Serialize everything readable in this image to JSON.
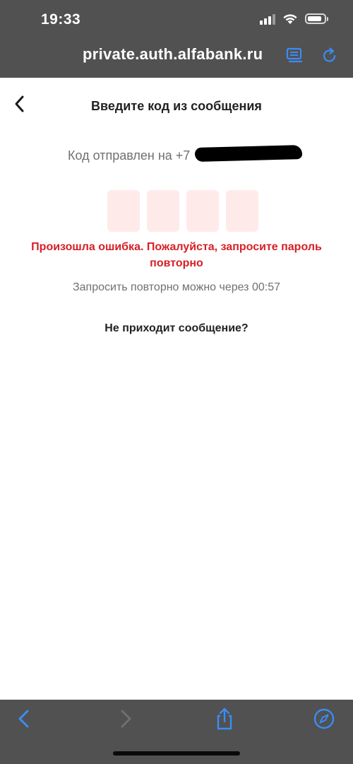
{
  "status_bar": {
    "time": "19:33",
    "battery_level": 0.85,
    "signal_bars": 3
  },
  "browser": {
    "url": "private.auth.alfabank.ru",
    "reader_icon": "reader-view-icon",
    "reload_icon": "reload-icon",
    "accent_color": "#3b8cf5"
  },
  "page": {
    "title": "Введите код из сообщения",
    "sent_to_label": "Код отправлен на +7",
    "code_digits": [
      "",
      "",
      "",
      ""
    ],
    "error_message": "Произошла ошибка. Пожалуйста, запросите пароль повторно",
    "resend_timer": "Запросить повторно можно через 00:57",
    "no_message_link": "Не приходит сообщение?",
    "error_color": "#d71f26",
    "code_box_color": "#ffeaea"
  },
  "toolbar": {
    "back_icon": "chevron-left-icon",
    "forward_icon": "chevron-right-icon",
    "share_icon": "share-icon",
    "compass_icon": "compass-icon"
  }
}
